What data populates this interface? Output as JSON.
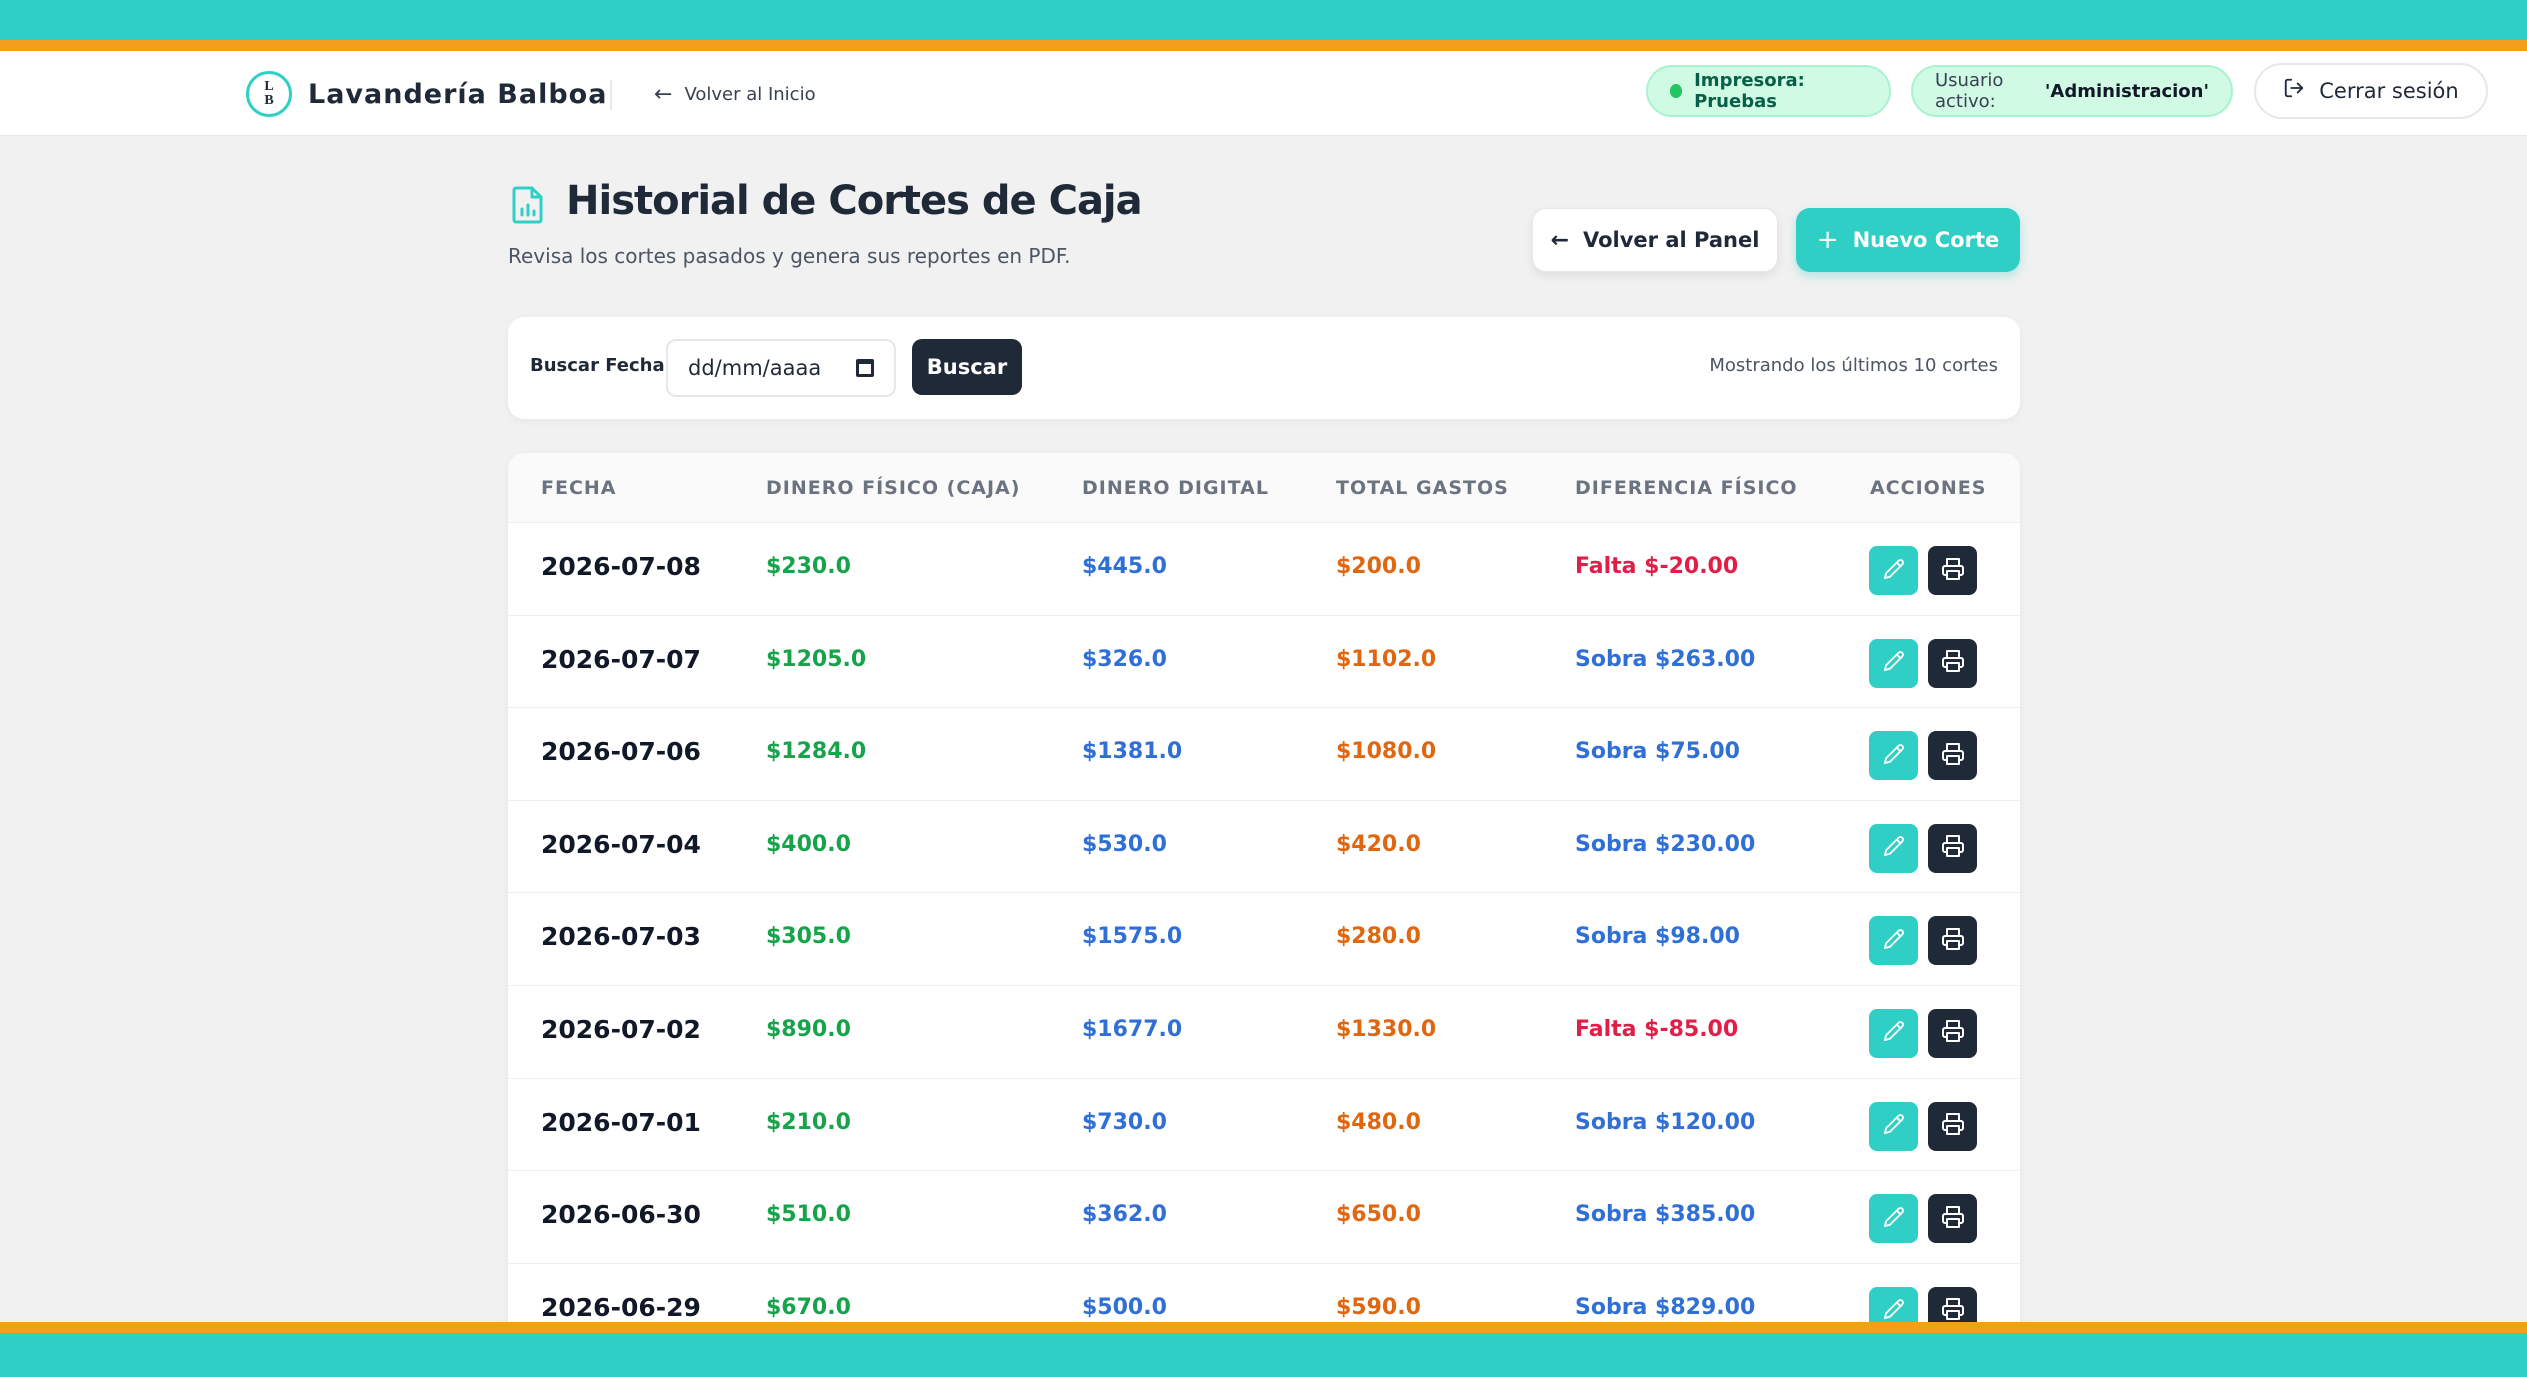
{
  "header": {
    "logo_letters": [
      "L",
      "B"
    ],
    "brand": "Lavandería Balboa",
    "back_home": "Volver al Inicio",
    "printer_status": "Impresora: Pruebas",
    "user_label": "Usuario activo:",
    "user_name": "'Administracion'",
    "logout": "Cerrar sesión"
  },
  "page": {
    "title": "Historial de Cortes de Caja",
    "subtitle": "Revisa los cortes pasados y genera sus reportes en PDF.",
    "back_panel": "Volver al Panel",
    "new_cut": "Nuevo Corte"
  },
  "filter": {
    "label": "Buscar Fecha:",
    "date_placeholder": "dd/mm/aaaa",
    "search_button": "Buscar",
    "showing": "Mostrando los últimos 10 cortes"
  },
  "table": {
    "headers": [
      "FECHA",
      "DINERO FÍSICO (CAJA)",
      "DINERO DIGITAL",
      "TOTAL GASTOS",
      "DIFERENCIA FÍSICO",
      "ACCIONES"
    ],
    "rows": [
      {
        "fecha": "2026-07-08",
        "fisico": "$230.0",
        "digital": "$445.0",
        "gastos": "$200.0",
        "diferencia": "Falta $-20.00",
        "status": "falta"
      },
      {
        "fecha": "2026-07-07",
        "fisico": "$1205.0",
        "digital": "$326.0",
        "gastos": "$1102.0",
        "diferencia": "Sobra $263.00",
        "status": "sobra"
      },
      {
        "fecha": "2026-07-06",
        "fisico": "$1284.0",
        "digital": "$1381.0",
        "gastos": "$1080.0",
        "diferencia": "Sobra $75.00",
        "status": "sobra"
      },
      {
        "fecha": "2026-07-04",
        "fisico": "$400.0",
        "digital": "$530.0",
        "gastos": "$420.0",
        "diferencia": "Sobra $230.00",
        "status": "sobra"
      },
      {
        "fecha": "2026-07-03",
        "fisico": "$305.0",
        "digital": "$1575.0",
        "gastos": "$280.0",
        "diferencia": "Sobra $98.00",
        "status": "sobra"
      },
      {
        "fecha": "2026-07-02",
        "fisico": "$890.0",
        "digital": "$1677.0",
        "gastos": "$1330.0",
        "diferencia": "Falta $-85.00",
        "status": "falta"
      },
      {
        "fecha": "2026-07-01",
        "fisico": "$210.0",
        "digital": "$730.0",
        "gastos": "$480.0",
        "diferencia": "Sobra $120.00",
        "status": "sobra"
      },
      {
        "fecha": "2026-06-30",
        "fisico": "$510.0",
        "digital": "$362.0",
        "gastos": "$650.0",
        "diferencia": "Sobra $385.00",
        "status": "sobra"
      },
      {
        "fecha": "2026-06-29",
        "fisico": "$670.0",
        "digital": "$500.0",
        "gastos": "$590.0",
        "diferencia": "Sobra $829.00",
        "status": "sobra"
      }
    ]
  },
  "icons": {
    "logout": "logout-icon",
    "edit": "pencil-icon",
    "print": "printer-icon",
    "page": "report-file-icon"
  },
  "colors": {
    "teal": "#2fcfc6",
    "orange": "#f59e1b",
    "dark": "#1f2937",
    "green": "#16a34a",
    "blue": "#2f6fd6",
    "amber": "#e06610",
    "red": "#e11d48"
  }
}
